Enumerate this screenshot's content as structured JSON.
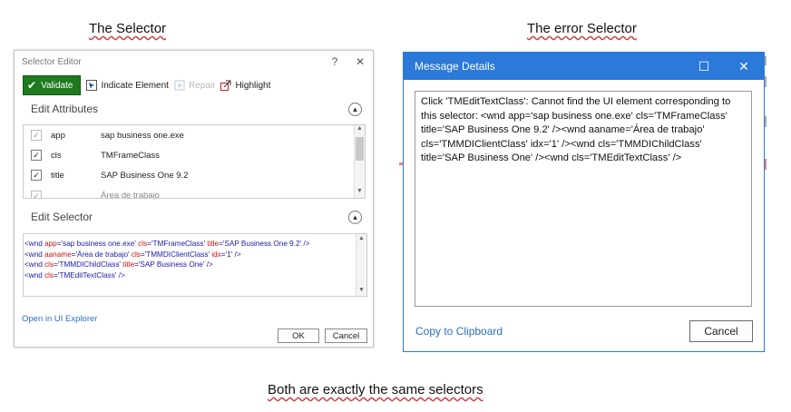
{
  "captions": {
    "left": "The Selector",
    "right": "The error Selector",
    "bottom": "Both are exactly the same selectors"
  },
  "selector_editor": {
    "title": "Selector Editor",
    "help_glyph": "?",
    "close_glyph": "✕",
    "toolbar": {
      "validate_label": "Validate",
      "indicate_label": "Indicate Element",
      "repair_label": "Repair",
      "highlight_label": "Highlight"
    },
    "edit_attributes_label": "Edit Attributes",
    "attributes": [
      {
        "name": "app",
        "value": "sap business one.exe",
        "checked": true,
        "greyed": true
      },
      {
        "name": "cls",
        "value": "TMFrameClass",
        "checked": true,
        "greyed": false
      },
      {
        "name": "title",
        "value": "SAP Business One 9.2",
        "checked": true,
        "greyed": false
      },
      {
        "name": "",
        "value": "Área de trabajo",
        "checked": true,
        "greyed": true
      }
    ],
    "edit_selector_label": "Edit Selector",
    "selector_lines": [
      {
        "tag": "<wnd ",
        "attrs": [
          [
            "app",
            "'sap business one.exe'"
          ],
          [
            "cls",
            "'TMFrameClass'"
          ],
          [
            "title",
            "'SAP Business One 9.2'"
          ]
        ],
        "end": " />"
      },
      {
        "tag": "<wnd ",
        "attrs": [
          [
            "aaname",
            "'Área de trabajo'"
          ],
          [
            "cls",
            "'TMMDIClientClass'"
          ],
          [
            "idx",
            "'1'"
          ]
        ],
        "end": " />"
      },
      {
        "tag": "<wnd ",
        "attrs": [
          [
            "cls",
            "'TMMDIChildClass'"
          ],
          [
            "title",
            "'SAP Business One'"
          ]
        ],
        "end": " />"
      },
      {
        "tag": "<wnd ",
        "attrs": [
          [
            "cls",
            "'TMEditTextClass'"
          ]
        ],
        "end": " />"
      }
    ],
    "open_explorer_label": "Open in UI Explorer",
    "ok_label": "OK",
    "cancel_label": "Cancel"
  },
  "message_details": {
    "title": "Message Details",
    "maximize_glyph": "☐",
    "close_glyph": "✕",
    "message": "Click 'TMEditTextClass': Cannot find the UI element corresponding to this selector: <wnd app='sap business one.exe' cls='TMFrameClass' title='SAP Business One 9.2' /><wnd aaname='Área de trabajo' cls='TMMDIClientClass' idx='1' /><wnd cls='TMMDIChildClass' title='SAP Business One' /><wnd cls='TMEditTextClass' />",
    "copy_label": "Copy to Clipboard",
    "cancel_label": "Cancel"
  },
  "colors": {
    "validate_green": "#1f7a1f",
    "titlebar_blue": "#2b79d8",
    "link_blue": "#2a6ec0",
    "selector_attr_red": "#d01010",
    "selector_tag_blue": "#1a1aa8"
  }
}
